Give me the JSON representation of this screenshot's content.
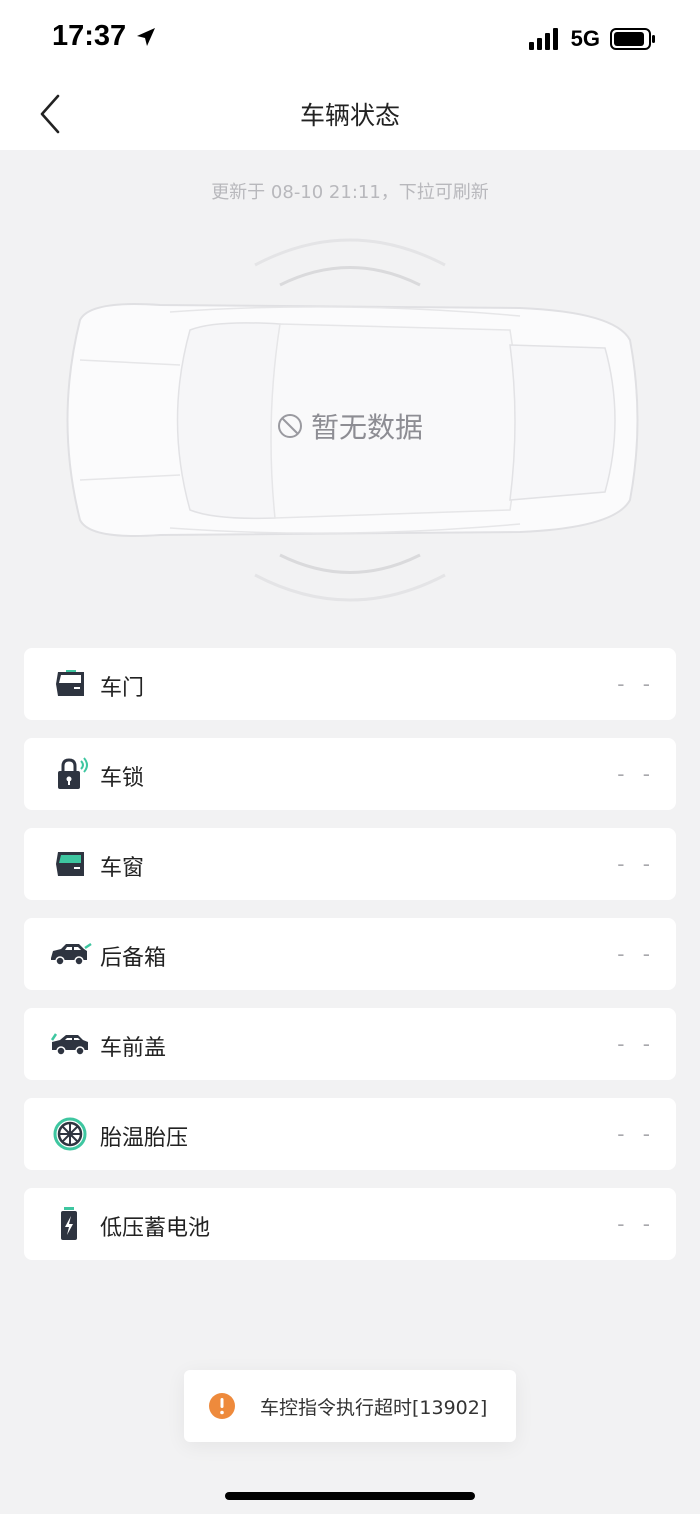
{
  "status_bar": {
    "time": "17:37",
    "network": "5G",
    "icons": [
      "location-arrow-icon",
      "signal-bars-icon",
      "battery-icon"
    ]
  },
  "nav": {
    "title": "车辆状态",
    "back_icon": "chevron-left-icon"
  },
  "update_hint": "更新于 08-10 21:11，下拉可刷新",
  "car": {
    "no_data": "暂无数据",
    "no_data_icon": "prohibited-icon"
  },
  "items": [
    {
      "label": "车门",
      "value": "- -",
      "icon": "car-door-icon"
    },
    {
      "label": "车锁",
      "value": "- -",
      "icon": "lock-icon"
    },
    {
      "label": "车窗",
      "value": "- -",
      "icon": "car-window-icon"
    },
    {
      "label": "后备箱",
      "value": "- -",
      "icon": "trunk-icon"
    },
    {
      "label": "车前盖",
      "value": "- -",
      "icon": "hood-icon"
    },
    {
      "label": "胎温胎压",
      "value": "- -",
      "icon": "tire-icon"
    },
    {
      "label": "低压蓄电池",
      "value": "- -",
      "icon": "battery-charge-icon"
    }
  ],
  "toast": {
    "text": "车控指令执行超时[13902]",
    "icon": "warning-icon"
  },
  "colors": {
    "background": "#f2f2f3",
    "icon_dark": "#2e3440",
    "accent_green": "#3ec6a0",
    "toast_orange": "#ee8a3c"
  }
}
